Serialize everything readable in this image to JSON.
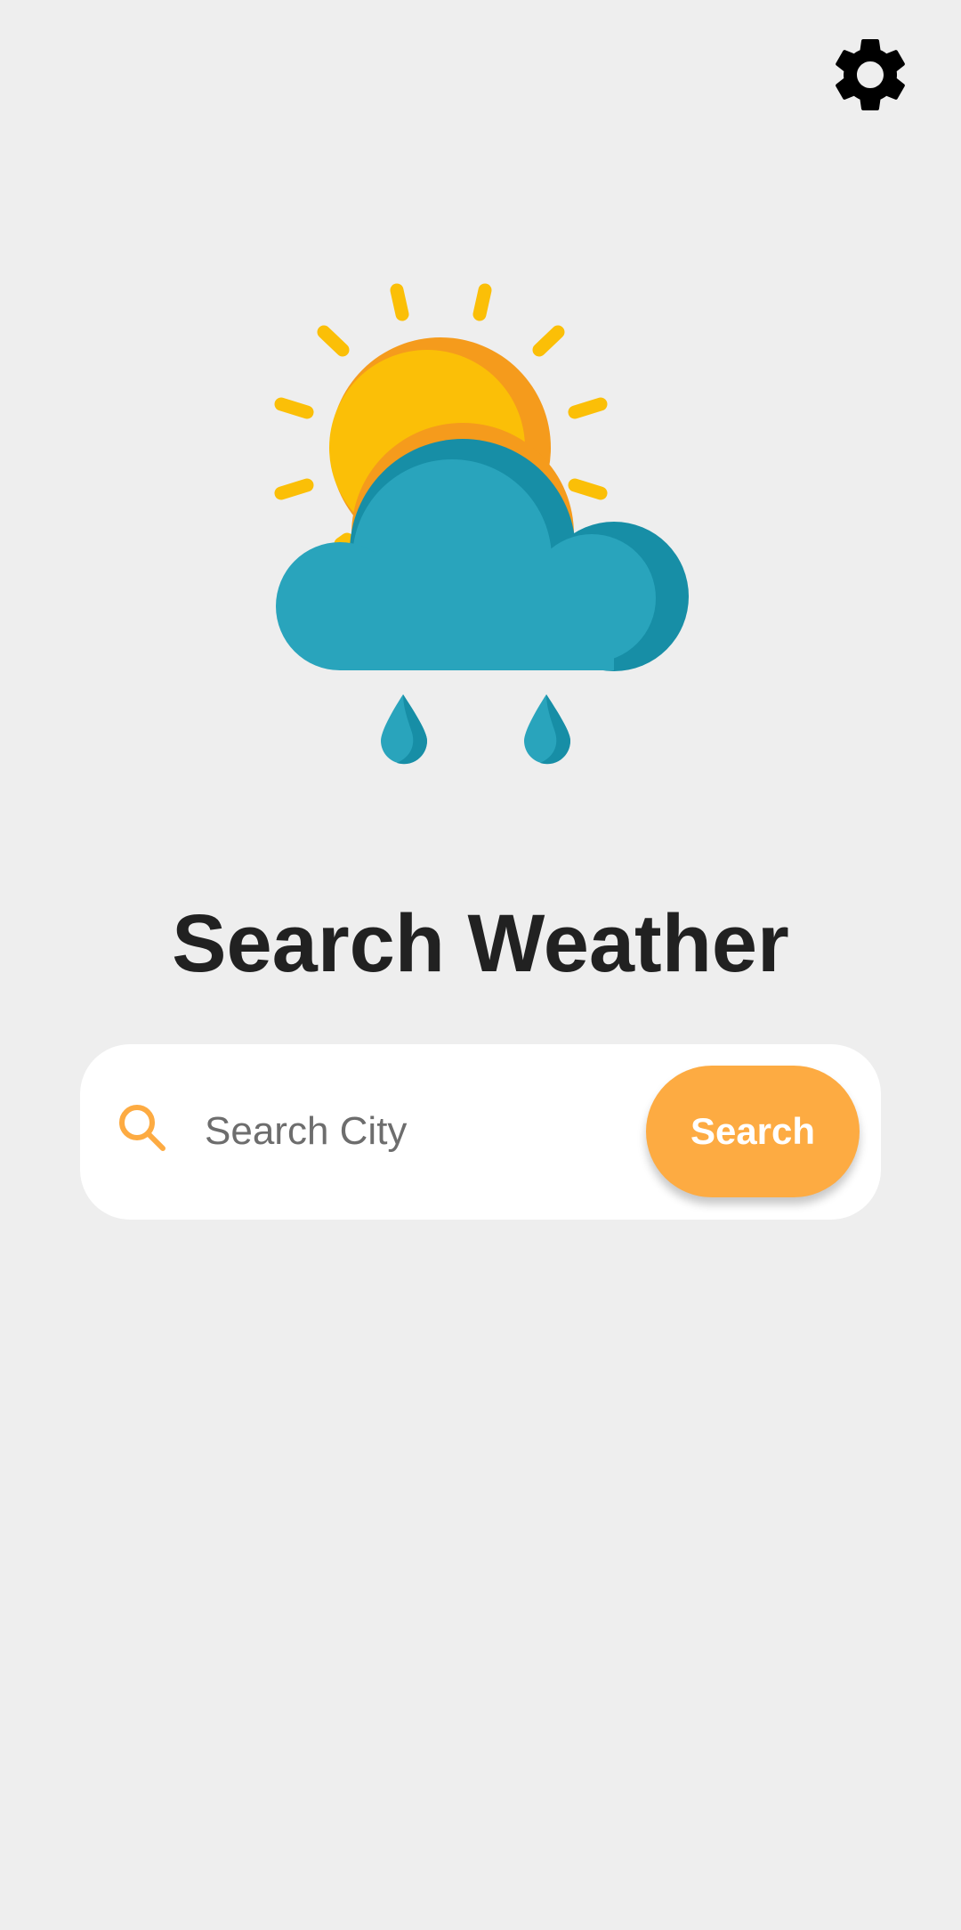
{
  "header": {
    "settings_icon": "gear-icon"
  },
  "illustration": {
    "icon": "sun-cloud-rain-icon",
    "colors": {
      "sun": "#fbbf07",
      "sun_shade": "#f59b1c",
      "cloud": "#29a4bc",
      "cloud_shade": "#178ea6"
    }
  },
  "main": {
    "title": "Search Weather"
  },
  "search": {
    "icon": "search-icon",
    "placeholder": "Search City",
    "value": "",
    "button_label": "Search"
  },
  "colors": {
    "background": "#eeeeee",
    "accent": "#fdab42",
    "card": "#ffffff",
    "title": "#212121"
  }
}
